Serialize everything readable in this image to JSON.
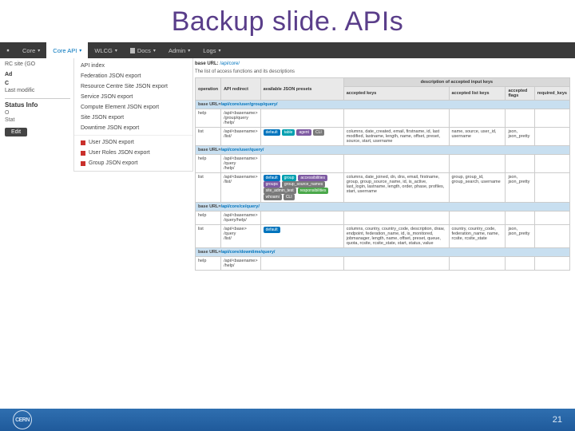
{
  "slide": {
    "title": "Backup slide. APIs",
    "page_number": "21",
    "footer_logo_text": "CERN"
  },
  "nav": {
    "items": [
      {
        "label": "Core",
        "active": false,
        "icon": ""
      },
      {
        "label": "Core API",
        "active": true,
        "icon": ""
      },
      {
        "label": "WLCG",
        "active": false,
        "icon": ""
      },
      {
        "label": "Docs",
        "active": false,
        "icon": "doc"
      },
      {
        "label": "Admin",
        "active": false,
        "icon": ""
      },
      {
        "label": "Logs",
        "active": false,
        "icon": ""
      }
    ]
  },
  "dropdown": [
    {
      "label": "API index",
      "icon": ""
    },
    {
      "label": "Federation JSON export",
      "icon": ""
    },
    {
      "label": "Resource Centre Site JSON export",
      "icon": ""
    },
    {
      "label": "Service JSON export",
      "icon": ""
    },
    {
      "label": "Compute Element JSON export",
      "icon": ""
    },
    {
      "label": "Site JSON export",
      "icon": ""
    },
    {
      "label": "Downtime JSON export",
      "icon": ""
    },
    {
      "divider": true
    },
    {
      "label": "User JSON export",
      "icon": "red"
    },
    {
      "label": "User Roles JSON export",
      "icon": "red"
    },
    {
      "label": "Group JSON export",
      "icon": "red"
    }
  ],
  "sidebar": {
    "line1a": "RC site (GO",
    "heading2": "Ad",
    "heading3": "C",
    "heading4": "Last modific",
    "status_title": "Status Info",
    "status_a": "O",
    "status_b": "Stat",
    "edit": "Edit"
  },
  "main": {
    "base_prefix": "base URL:",
    "base_link": "/api/core/",
    "intro": "The list of access functions and its descriptions",
    "header": {
      "operation": "operation",
      "redirect": "API redirect",
      "presets": "available JSON presets",
      "group": "description of accepted input keys",
      "accepted_keys": "accepted keys",
      "accepted_list_keys": "accepted list keys",
      "accepted_flags": "accepted flags",
      "required_keys": "required_keys"
    },
    "sections": [
      {
        "base": "base URL=/api/core/user/group/query/",
        "rows": [
          {
            "op": "help",
            "redirect": "/api/<basename>\n/group/query\n/help/",
            "presets": "",
            "keys": "",
            "list": "",
            "flags": "",
            "req": ""
          },
          {
            "op": "list",
            "redirect": "/api/<basename>\n/list/",
            "presets_badges": [
              "default|b-blue",
              "table|b-teal",
              "agent|b-purple",
              "CLI|b-gray"
            ],
            "keys": "columns, date_created, email, firstname, id, last modified, lastname, length, name, offset, preset, source, start, username",
            "list": "name, source, user_id, username",
            "flags": "json, json_pretty",
            "req": ""
          }
        ]
      },
      {
        "base": "base URL=/api/core/user/query/",
        "rows": [
          {
            "op": "help",
            "redirect": "/api/<basename>\n/query\n/help/",
            "presets": "",
            "keys": "",
            "list": "",
            "flags": "",
            "req": ""
          },
          {
            "op": "list",
            "redirect": "/api/<basename>\n/list/",
            "presets_badges": [
              "default|b-blue",
              "group|b-teal",
              "accessibilities|b-purple",
              "groups|b-purple",
              "group_source_names|b-gray",
              "site_admin_test|b-gray",
              "responsibilities|b-green",
              "whoami|b-gray",
              "CLI|b-gray"
            ],
            "keys": "columns, date_joined, dn, dns, email, firstname, group, group_source_name, id, is_active, last_login, lastname, length, order, phase, profiles, start, username",
            "list": "group, group_id, group_search, username",
            "flags": "json, json_pretty",
            "req": ""
          }
        ]
      },
      {
        "base": "base URL=/api/core/ce/query/",
        "rows": [
          {
            "op": "help",
            "redirect": "/api/<basename>\n/query/help/",
            "presets": "",
            "keys": "",
            "list": "",
            "flags": "",
            "req": ""
          },
          {
            "op": "list",
            "redirect": "/api/<base>\n/query\n/list/",
            "presets_badges": [
              "default|b-blue"
            ],
            "keys": "columns, country, country_code, description, draw, endpoint, federation_name, id, is_monitored, jobmanager, length, name, offset, preset, queue, quota, rcsite, rcsite_state, start, status, value",
            "list": "country, country_code, federation_name, name, rcsite, rcsite_state",
            "flags": "json, json_pretty",
            "req": ""
          }
        ]
      },
      {
        "base": "base URL=/api/core/downtime/query/",
        "rows": [
          {
            "op": "help",
            "redirect": "/api/<basename>\n/help/",
            "presets": "",
            "keys": "",
            "list": "",
            "flags": "",
            "req": ""
          }
        ]
      }
    ]
  }
}
